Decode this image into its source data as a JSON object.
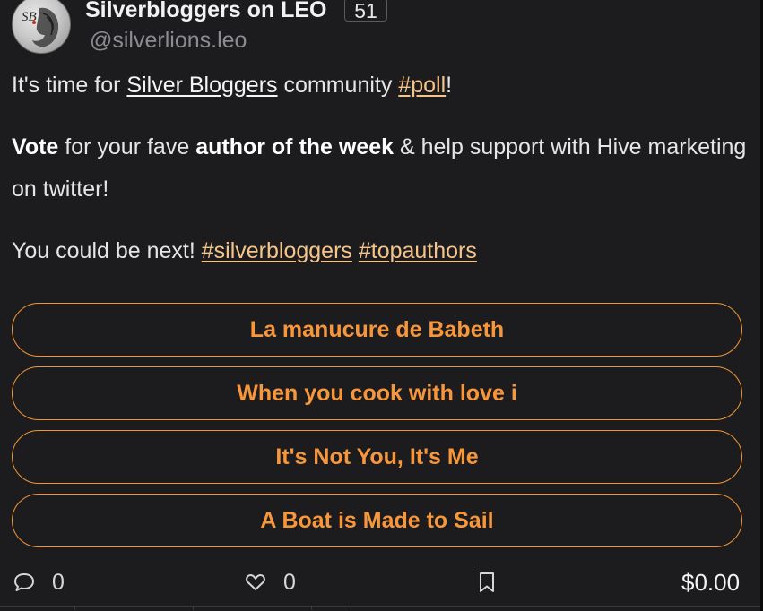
{
  "author": {
    "display_name": "Silverbloggers on LEO",
    "reputation": "51",
    "handle": "@silverlions.leo",
    "avatar_icon": "lion-crest-logo"
  },
  "post": {
    "p1": {
      "prefix": "It's time for ",
      "community_link": "Silver Bloggers",
      "middle": " community ",
      "tag": "#poll",
      "suffix": "!"
    },
    "p2": {
      "bold1": "Vote",
      "text1": " for your fave ",
      "bold2": "author of the week",
      "text2": " & help support with Hive marketing on twitter!"
    },
    "p3": {
      "text": "You could be next! ",
      "tag1": "#silverbloggers",
      "tag2": "#topauthors"
    }
  },
  "poll": {
    "options": [
      "La manucure de Babeth",
      "When you cook with love i",
      "It's Not You, It's Me",
      "A Boat is Made to Sail"
    ],
    "accent_color": "#f7963a"
  },
  "actions": {
    "comments": "0",
    "likes": "0",
    "payout": "$0.00",
    "icons": [
      "comment-icon",
      "heart-icon",
      "bookmark-icon"
    ]
  }
}
